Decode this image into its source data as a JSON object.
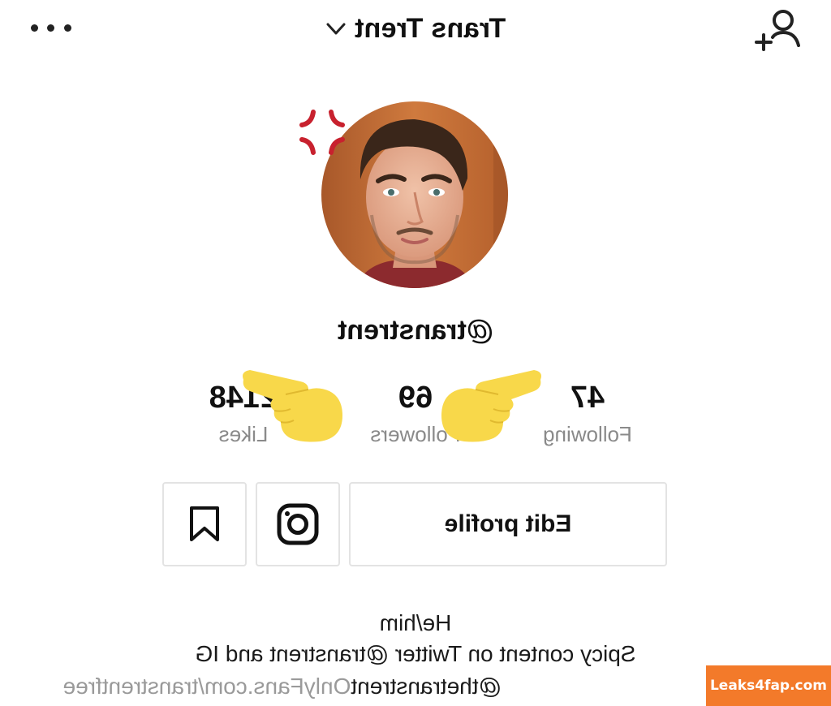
{
  "header": {
    "title": "Trans Trent",
    "chevron_icon": "chevron-down-icon",
    "add_user_icon": "add-user-icon",
    "more_icon": "more-horizontal-icon"
  },
  "profile": {
    "username": "@transtrent",
    "reaction_icon": "anger-symbol-icon"
  },
  "stats": {
    "following": {
      "value": "47",
      "label": "Following"
    },
    "followers": {
      "value": "69",
      "label": "Followers"
    },
    "likes": {
      "value": "2148",
      "label": "Likes"
    },
    "pointer_icon": "pointing-hand-icon"
  },
  "actions": {
    "edit_profile_label": "Edit profile",
    "instagram_icon": "instagram-icon",
    "bookmark_icon": "bookmark-icon"
  },
  "bio": {
    "line1": "He/him",
    "line2": "Spicy content on Twitter @transtrent and IG",
    "line3_handle": "@thetranstrent",
    "line3_link": "OnlyFans.com/transtrentfree"
  },
  "watermark": {
    "text": "Leaks4fap.com"
  },
  "colors": {
    "accent_anger": "#c8212e",
    "emoji_yellow": "#f8d84a",
    "muted_text": "#8a8a8a",
    "button_border": "#e3e3e3",
    "watermark_bg": "#f37a2a"
  }
}
